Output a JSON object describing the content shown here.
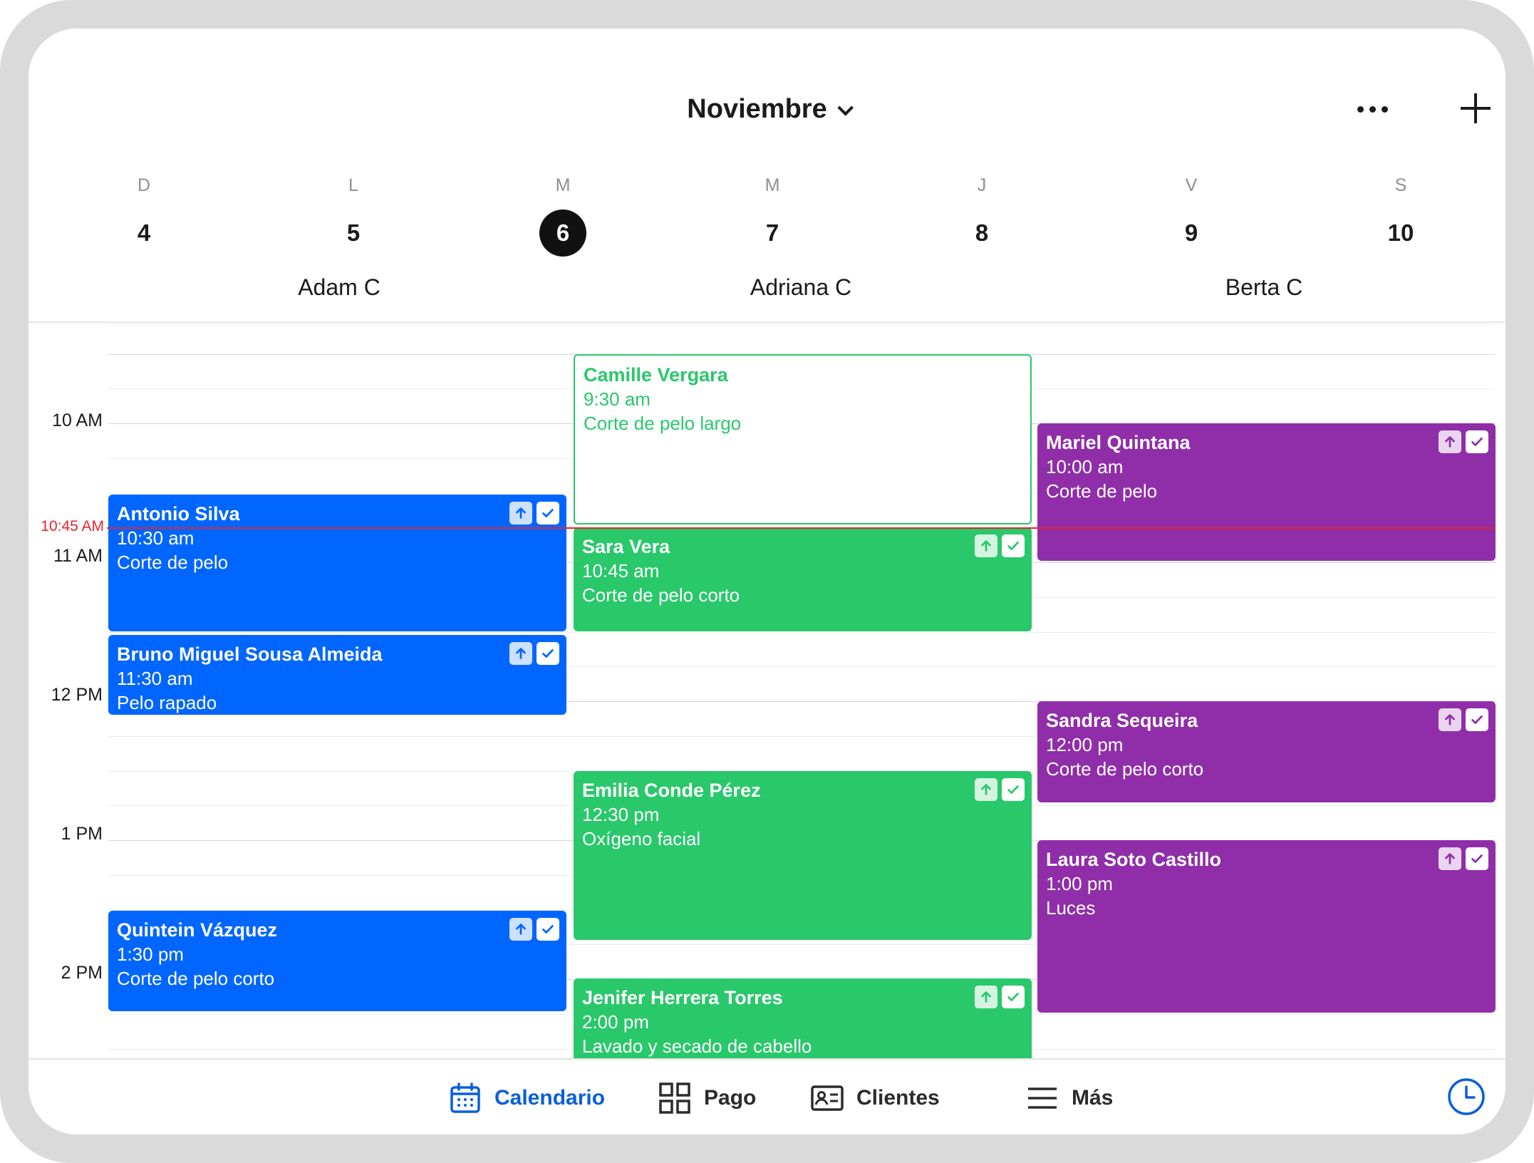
{
  "header": {
    "month": "Noviembre",
    "more_icon": "more-horizontal-icon",
    "add_icon": "plus-icon"
  },
  "week": {
    "days": [
      {
        "letter": "D",
        "num": "4"
      },
      {
        "letter": "L",
        "num": "5"
      },
      {
        "letter": "M",
        "num": "6",
        "selected": true
      },
      {
        "letter": "M",
        "num": "7"
      },
      {
        "letter": "J",
        "num": "8"
      },
      {
        "letter": "V",
        "num": "9"
      },
      {
        "letter": "S",
        "num": "10"
      }
    ]
  },
  "staff": [
    "Adam C",
    "Adriana C",
    "Berta C"
  ],
  "times": [
    "10 AM",
    "11 AM",
    "12 PM",
    "1 PM",
    "2 PM"
  ],
  "now": {
    "label": "10:45 AM"
  },
  "colors": {
    "blue": "#0066ff",
    "green": "#29c86a",
    "purple": "#8f2ea8",
    "now_line": "#e8242a",
    "nav_active": "#0a5fd9"
  },
  "events": {
    "adam": [
      {
        "name": "Antonio Silva",
        "time": "10:30 am",
        "service": "Corte de pelo"
      },
      {
        "name": "Bruno Miguel Sousa Almeida",
        "time": "11:30 am",
        "service": "Pelo rapado"
      },
      {
        "name": "Quintein Vázquez",
        "time": "1:30 pm",
        "service": "Corte de pelo corto"
      }
    ],
    "adriana": [
      {
        "name": "Camille Vergara",
        "time": "9:30 am",
        "service": "Corte de pelo largo"
      },
      {
        "name": "Sara Vera",
        "time": "10:45 am",
        "service": "Corte de pelo corto"
      },
      {
        "name": "Emilia Conde Pérez",
        "time": "12:30 pm",
        "service": "Oxígeno facial"
      },
      {
        "name": "Jenifer Herrera Torres",
        "time": "2:00 pm",
        "service": "Lavado y secado de cabello"
      }
    ],
    "berta": [
      {
        "name": "Mariel Quintana",
        "time": "10:00 am",
        "service": "Corte de pelo"
      },
      {
        "name": "Sandra Sequeira",
        "time": "12:00 pm",
        "service": "Corte de pelo corto"
      },
      {
        "name": "Laura Soto Castillo",
        "time": "1:00 pm",
        "service": "Luces"
      }
    ]
  },
  "nav": {
    "calendar": "Calendario",
    "payment": "Pago",
    "clients": "Clientes",
    "more": "Más"
  }
}
